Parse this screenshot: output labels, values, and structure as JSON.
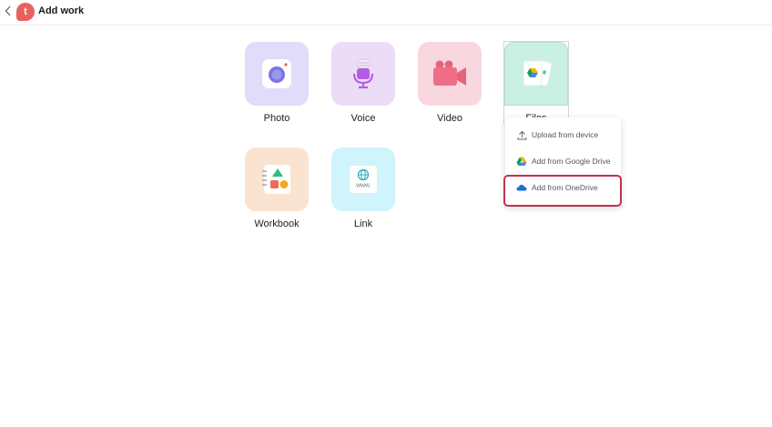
{
  "header": {
    "title": "Add work",
    "logo_letter": "t",
    "back_icon": "chevron-left-icon"
  },
  "tiles": [
    {
      "label": "Photo",
      "icon": "camera-icon",
      "color": "#e0dcf9"
    },
    {
      "label": "Voice",
      "icon": "microphone-icon",
      "color": "#ecdcf5"
    },
    {
      "label": "Video",
      "icon": "video-camera-icon",
      "color": "#f8d8de"
    },
    {
      "label": "Files",
      "icon": "files-icon",
      "color": "#c9f0e2"
    },
    {
      "label": "Workbook",
      "icon": "workbook-icon",
      "color": "#fbe3d2"
    },
    {
      "label": "Link",
      "icon": "globe-link-icon",
      "color": "#cff4fb"
    }
  ],
  "files_menu": {
    "items": [
      {
        "label": "Upload from device",
        "icon": "upload-icon"
      },
      {
        "label": "Add from Google Drive",
        "icon": "google-drive-icon"
      },
      {
        "label": "Add from OneDrive",
        "icon": "onedrive-icon"
      }
    ],
    "highlighted_index": 2,
    "highlight_color": "#c0334d"
  }
}
